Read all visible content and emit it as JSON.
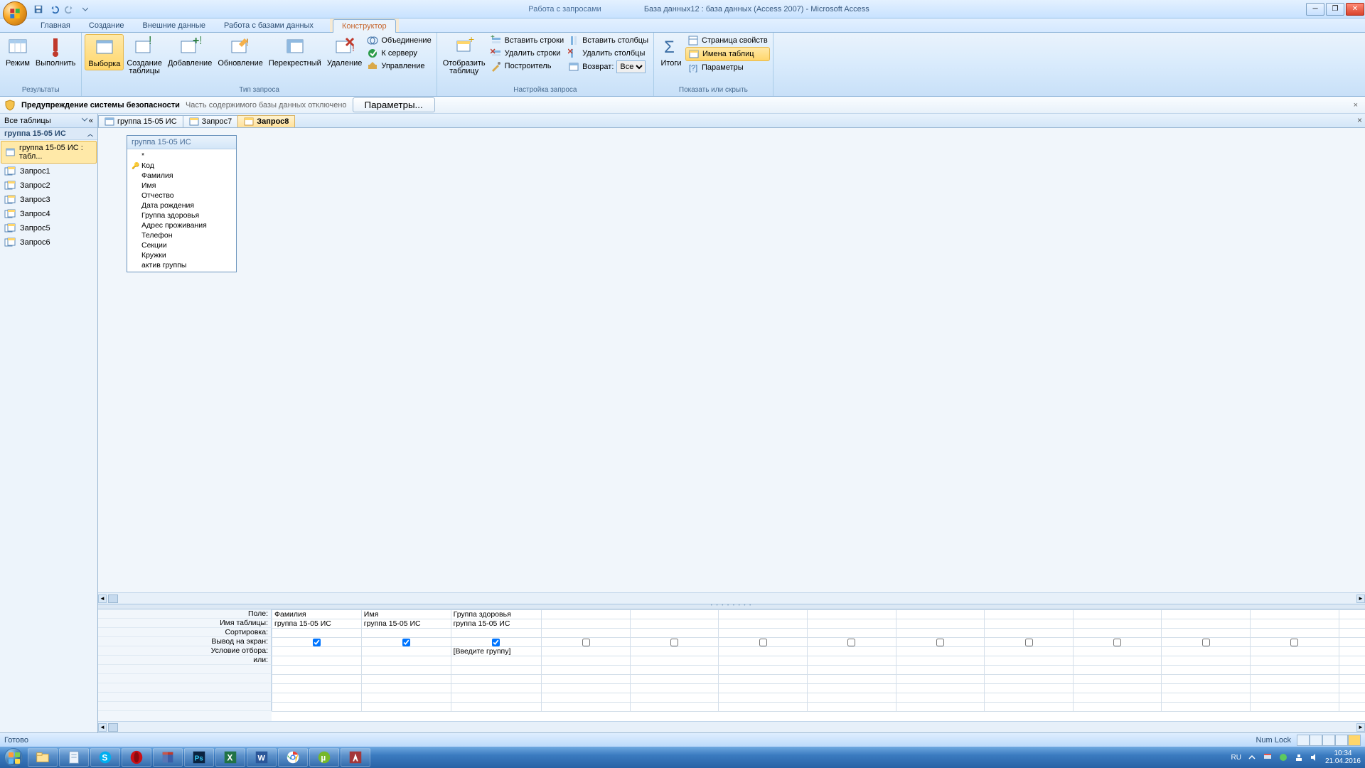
{
  "titlebar": {
    "context_title": "Работа с запросами",
    "app_title": "База данных12 : база данных (Access 2007) - Microsoft Access"
  },
  "ribbon_tabs": {
    "home": "Главная",
    "create": "Создание",
    "external": "Внешние данные",
    "dbtools": "Работа с базами данных",
    "designer": "Конструктор"
  },
  "ribbon": {
    "group_results": {
      "label": "Результаты",
      "mode": "Режим",
      "run": "Выполнить"
    },
    "group_qtype": {
      "label": "Тип запроса",
      "select": "Выборка",
      "maketable": "Создание\nтаблицы",
      "append": "Добавление",
      "update": "Обновление",
      "crosstab": "Перекрестный",
      "delete": "Удаление",
      "union": "Объединение",
      "passthrough": "К серверу",
      "ddl": "Управление"
    },
    "group_setup": {
      "label": "Настройка запроса",
      "showtable": "Отобразить\nтаблицу",
      "insrows": "Вставить строки",
      "delrows": "Удалить строки",
      "builder": "Построитель",
      "inscols": "Вставить столбцы",
      "delcols": "Удалить столбцы",
      "return": "Возврат:",
      "return_val": "Все"
    },
    "group_totals": {
      "label": "Показать или скрыть",
      "totals": "Итоги",
      "propsheet": "Страница свойств",
      "tablenames": "Имена таблиц",
      "params": "Параметры"
    }
  },
  "security": {
    "title": "Предупреждение системы безопасности",
    "msg": "Часть содержимого базы данных отключено",
    "btn": "Параметры..."
  },
  "nav": {
    "header": "Все таблицы",
    "group": "группа 15-05 ИС",
    "table": "группа 15-05 ИС : табл...",
    "queries": [
      "Запрос1",
      "Запрос2",
      "Запрос3",
      "Запрос4",
      "Запрос5",
      "Запрос6"
    ]
  },
  "doctabs": {
    "t1": "группа 15-05 ИС",
    "t2": "Запрос7",
    "t3": "Запрос8"
  },
  "tablecard": {
    "title": "группа 15-05 ИС",
    "star": "*",
    "fields": [
      "Код",
      "Фамилия",
      "Имя",
      "Отчество",
      "Дата рождения",
      "Группа здоровья",
      "Адрес проживания",
      "Телефон",
      "Секции",
      "Кружки",
      "актив группы"
    ]
  },
  "grid": {
    "labels": {
      "field": "Поле:",
      "table": "Имя таблицы:",
      "sort": "Сортировка:",
      "show": "Вывод на экран:",
      "criteria": "Условие отбора:",
      "or": "или:"
    },
    "cols": [
      {
        "field": "Фамилия",
        "table": "группа 15-05 ИС",
        "show": true,
        "criteria": ""
      },
      {
        "field": "Имя",
        "table": "группа 15-05 ИС",
        "show": true,
        "criteria": ""
      },
      {
        "field": "Группа здоровья",
        "table": "группа 15-05 ИС",
        "show": true,
        "criteria": "[Введите группу]"
      }
    ]
  },
  "status": {
    "ready": "Готово",
    "numlock": "Num Lock"
  },
  "tray": {
    "lang": "RU",
    "time": "10:34",
    "date": "21.04.2016"
  }
}
